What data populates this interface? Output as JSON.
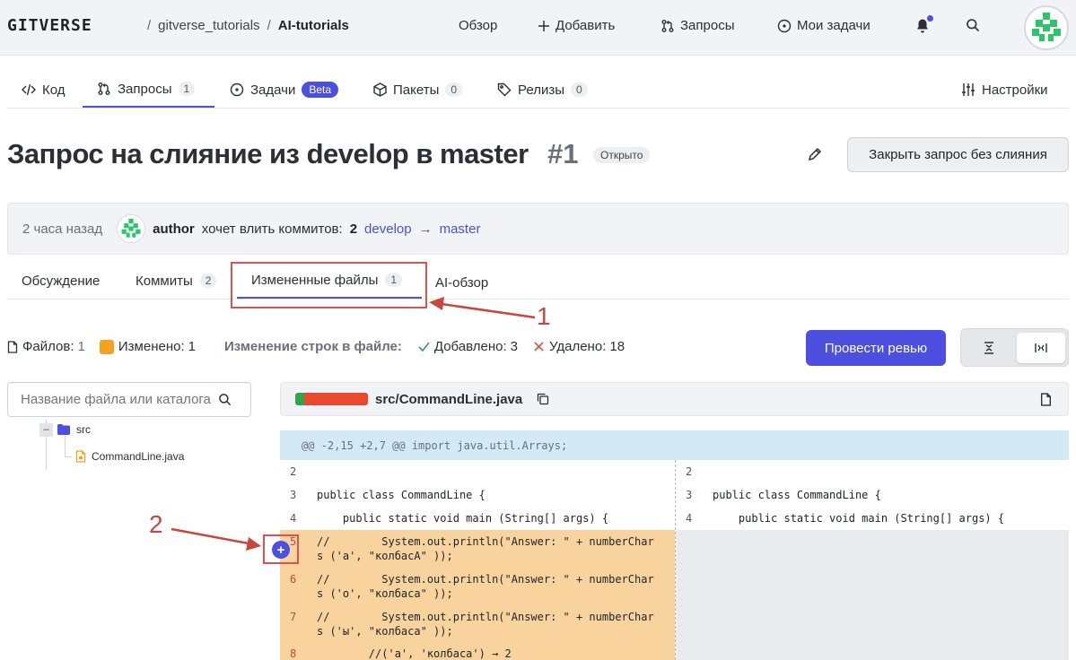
{
  "header": {
    "logo": "GITVERSE",
    "breadcrumb": [
      "gitverse_tutorials",
      "AI-tutorials"
    ],
    "nav": [
      {
        "label": "Обзор",
        "icon": ""
      },
      {
        "label": "Добавить",
        "icon": "plus-icon"
      },
      {
        "label": "Запросы",
        "icon": "pull-request-icon"
      },
      {
        "label": "Мои задачи",
        "icon": "issue-icon"
      }
    ]
  },
  "repo_tabs": {
    "code": "Код",
    "requests": "Запросы",
    "requests_count": "1",
    "tasks": "Задачи",
    "tasks_badge": "Beta",
    "packages": "Пакеты",
    "packages_count": "0",
    "releases": "Релизы",
    "releases_count": "0",
    "settings": "Настройки"
  },
  "pr": {
    "title": "Запрос на слияние из develop в master",
    "number": "#1",
    "status": "Открыто",
    "close_button": "Закрыть запрос без слияния",
    "time": "2 часа назад",
    "author": "author",
    "wants_merge": "хочет влить коммитов:",
    "commit_count": "2",
    "from_branch": "develop",
    "arrow": "→",
    "to_branch": "master"
  },
  "pr_tabs": {
    "discussion": "Обсуждение",
    "commits": "Коммиты",
    "commits_count": "2",
    "changed_files": "Измененные файлы",
    "changed_files_count": "1",
    "ai_review": "AI-обзор"
  },
  "annotations": {
    "one": "1",
    "two": "2"
  },
  "stats": {
    "files_label": "Файлов:",
    "files_value": "1",
    "changed_label": "Изменено:",
    "changed_value": "1",
    "line_changes_label": "Изменение строк в файле:",
    "added_label": "Добавлено:",
    "added_value": "3",
    "removed_label": "Удалено:",
    "removed_value": "18",
    "review_button": "Провести ревью"
  },
  "file_search": {
    "placeholder": "Название файла или каталога"
  },
  "tree": {
    "folder": "src",
    "file": "CommandLine.java",
    "collapse": "–"
  },
  "file": {
    "name": "src/CommandLine.java"
  },
  "diff": {
    "hunk": "@@ -2,15 +2,7 @@ import java.util.Arrays;",
    "left": [
      {
        "num": "2",
        "code": ""
      },
      {
        "num": "3",
        "code": "public class CommandLine {"
      },
      {
        "num": "4",
        "code": "    public static void main (String[] args) {"
      },
      {
        "num": "5",
        "code": "//        System.out.println(\"Answer: \" + numberChar\ns ('a', \"колбасА\" ));"
      },
      {
        "num": "6",
        "code": "//        System.out.println(\"Answer: \" + numberChar\ns ('o', \"колбаса\" ));"
      },
      {
        "num": "7",
        "code": "//        System.out.println(\"Answer: \" + numberChar\ns ('ы', \"колбаса\" ));"
      },
      {
        "num": "8",
        "code": "        //('a', 'колбаса') → 2"
      }
    ],
    "right": [
      {
        "num": "2",
        "code": ""
      },
      {
        "num": "3",
        "code": "public class CommandLine {"
      },
      {
        "num": "4",
        "code": "    public static void main (String[] args) {"
      }
    ]
  },
  "colors": {
    "accent": "#4c4fe0",
    "deleted_bg": "#f8d39e",
    "annotation": "#c9463f",
    "hunk_bg": "#d3e9f5"
  }
}
